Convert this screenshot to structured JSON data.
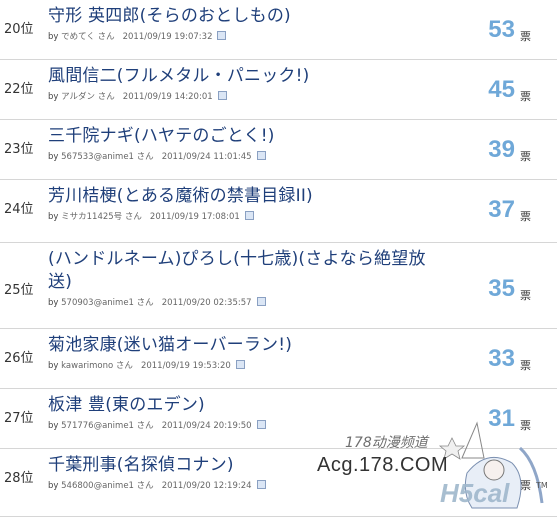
{
  "ranking": [
    {
      "rank": "20位",
      "title": "守形 英四郎(そらのおとしもの)",
      "user": "でめてく",
      "by": "by",
      "san": "さん",
      "timestamp": "2011/09/19 19:07:32",
      "votes": "53",
      "unit": "票"
    },
    {
      "rank": "22位",
      "title": "風間信二(フルメタル・パニック!)",
      "user": "アルダン",
      "by": "by",
      "san": "さん",
      "timestamp": "2011/09/19 14:20:01",
      "votes": "45",
      "unit": "票"
    },
    {
      "rank": "23位",
      "title": "三千院ナギ(ハヤテのごとく!)",
      "user": "567533@anime1",
      "by": "by",
      "san": "さん",
      "timestamp": "2011/09/24 11:01:45",
      "votes": "39",
      "unit": "票"
    },
    {
      "rank": "24位",
      "title": "芳川桔梗(とある魔術の禁書目録II)",
      "user": "ミサカ11425号",
      "by": "by",
      "san": "さん",
      "timestamp": "2011/09/19 17:08:01",
      "votes": "37",
      "unit": "票"
    },
    {
      "rank": "25位",
      "title": "(ハンドルネーム)ぴろし(十七歳)(さよなら絶望放送)",
      "user": "570903@anime1",
      "by": "by",
      "san": "さん",
      "timestamp": "2011/09/20 02:35:57",
      "votes": "35",
      "unit": "票"
    },
    {
      "rank": "26位",
      "title": "菊池家康(迷い猫オーバーラン!)",
      "user": "kawarimono",
      "by": "by",
      "san": "さん",
      "timestamp": "2011/09/19 19:53:20",
      "votes": "33",
      "unit": "票"
    },
    {
      "rank": "27位",
      "title": "板津 豊(東のエデン)",
      "user": "571776@anime1",
      "by": "by",
      "san": "さん",
      "timestamp": "2011/09/24 20:19:50",
      "votes": "31",
      "unit": "票"
    },
    {
      "rank": "28位",
      "title": "千葉刑事(名探偵コナン)",
      "user": "546800@anime1",
      "by": "by",
      "san": "さん",
      "timestamp": "2011/09/20 12:19:24",
      "votes": "27",
      "unit": "票"
    }
  ],
  "watermark": {
    "site_cn": "178动漫频道",
    "site": "Acg.178.COM",
    "logo": "H5cal",
    "tm": "TM"
  },
  "colors": {
    "title": "#1f3f7a",
    "votes": "#6fa8d8",
    "divider": "#d6d6d6"
  },
  "icons": [
    "info-icon"
  ]
}
